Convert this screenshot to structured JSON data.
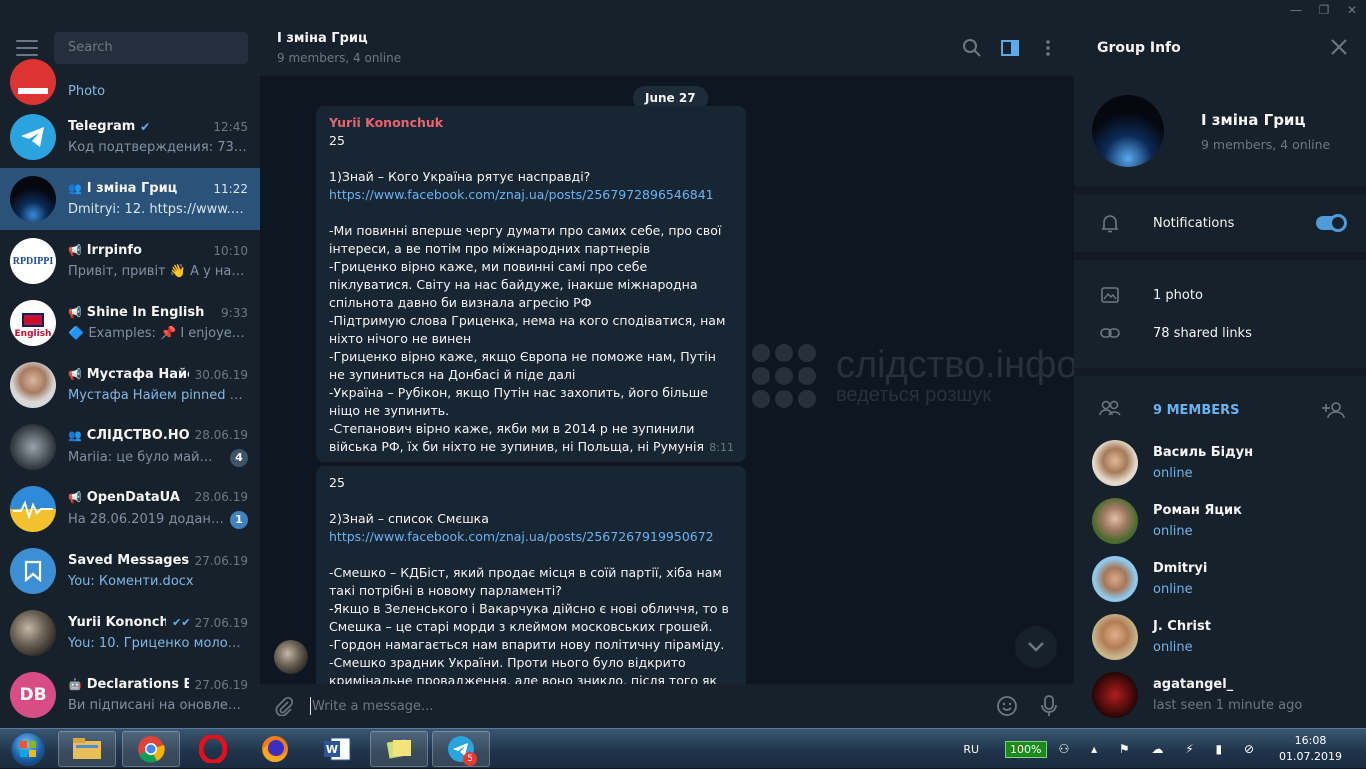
{
  "search": {
    "placeholder": "Search"
  },
  "chats": [
    {
      "name": "",
      "time": "",
      "message": "Photo",
      "avatar": "red"
    },
    {
      "name": "Telegram",
      "time": "12:45",
      "message": "Код подтверждения: 73414...",
      "verified": true
    },
    {
      "name": "І зміна Гриц",
      "time": "11:22",
      "message": "Dmitryi: 12. https://www.face...",
      "group": true,
      "active": true
    },
    {
      "name": "Irrpinfo",
      "time": "10:10",
      "message": "Привіт,  привіт 👋  А у нас х...",
      "channel": true
    },
    {
      "name": "Shine In English",
      "time": "9:33",
      "message": "🔷 Examples: 📌 I enjoyed ...",
      "channel": true
    },
    {
      "name": "Мустафа Найем",
      "time": "30.06.19",
      "message": "Мустафа Найем pinned «На...",
      "channel": true
    },
    {
      "name": "СЛІДСТВО.НО...",
      "time": "28.06.19",
      "message": "Mariia: це було майже д...",
      "badge": "4",
      "group": true
    },
    {
      "name": "OpenDataUA",
      "time": "28.06.19",
      "message": "На 28.06.2019 додано 2 с...",
      "badge": "1",
      "channel": true
    },
    {
      "name": "Saved Messages",
      "time": "27.06.19",
      "message": "You: Коменти.docx"
    },
    {
      "name": "Yurii Kononchuk",
      "time": "27.06.19",
      "message": "You: 10. Гриценко молодец...",
      "read": true
    },
    {
      "name": "Declarations Bot",
      "time": "27.06.19",
      "message": "Ви підписані на оновлення ...",
      "initials": "DB",
      "bot": true
    }
  ],
  "chat_header": {
    "title": "І зміна Гриц",
    "subtitle": "9 members, 4 online"
  },
  "date_pill": "June 27",
  "messages": [
    {
      "author": "Yurii Kononchuk",
      "time": "8:11",
      "line1": "25",
      "line2": "1)Знай – Кого Україна рятує насправді?",
      "link": "https://www.facebook.com/znaj.ua/posts/2567972896546841",
      "body": "-Ми повинні вперше чергу думати про самих себе, про свої інтереси, а ве потім про міжнародних партнерів\n-Гриценко вірно каже, ми повинні самі про себе піклуватися. Світу на нас байдуже, інакше міжнародна спільнота давно би визнала агресію РФ\n-Підтримую слова Гриценка, нема на кого сподіватися, нам ніхто нічого не винен\n-Гриценко вірно каже, якщо Європа не поможе нам, Путін не зупиниться на Донбасі й піде далі\n-Україна – Рубікон, якщо Путін нас захопить, його більше ніщо не зупинить.\n-Степанович вірно каже, якби ми в 2014 р не зупинили війська РФ, їх би ніхто не зупинив, ні Польща, ні Румунія"
    },
    {
      "line1": "25",
      "line2": "2)Знай – список Смєшка",
      "link": "https://www.facebook.com/znaj.ua/posts/2567267919950672",
      "body": "-Смешко – КДБіст, який продає місця в соїй партії, хіба нам такі потрібні в новому парламенті?\n-Якщо в Зеленського і Вакарчука дійсно є нові обличчя, то в Смешка – це старі морди з клеймом московських грошей.\n-Гордон намагається нам впарити нову політичну піраміду.\n-Смешко зрадник України. Проти нього було відкрито кримінальне провадження, але воно зникло, після того як"
    }
  ],
  "watermark": {
    "title": "слідство.інфо",
    "subtitle": "ведеться розшук"
  },
  "composer": {
    "placeholder": "Write a message..."
  },
  "group_info": {
    "heading": "Group Info",
    "title": "І зміна Гриц",
    "subtitle": "9 members, 4 online",
    "notifications_label": "Notifications",
    "notifications_on": true,
    "photos": "1 photo",
    "links": "78 shared links",
    "members_label": "9 MEMBERS",
    "members": [
      {
        "name": "Василь Бідун",
        "status": "online"
      },
      {
        "name": "Роман Яцик",
        "status": "online"
      },
      {
        "name": "Dmitryi",
        "status": "online"
      },
      {
        "name": "J. Christ",
        "status": "online"
      },
      {
        "name": "agatangel_",
        "status": "last seen 1 minute ago"
      }
    ]
  },
  "taskbar": {
    "language": "RU",
    "battery": "100%",
    "time": "16:08",
    "date": "01.07.2019",
    "telegram_badge": "5"
  },
  "colors": {
    "accent": "#2b5278",
    "link": "#6ab3f3",
    "author": "#e9646c",
    "badge": "#4082bc"
  }
}
